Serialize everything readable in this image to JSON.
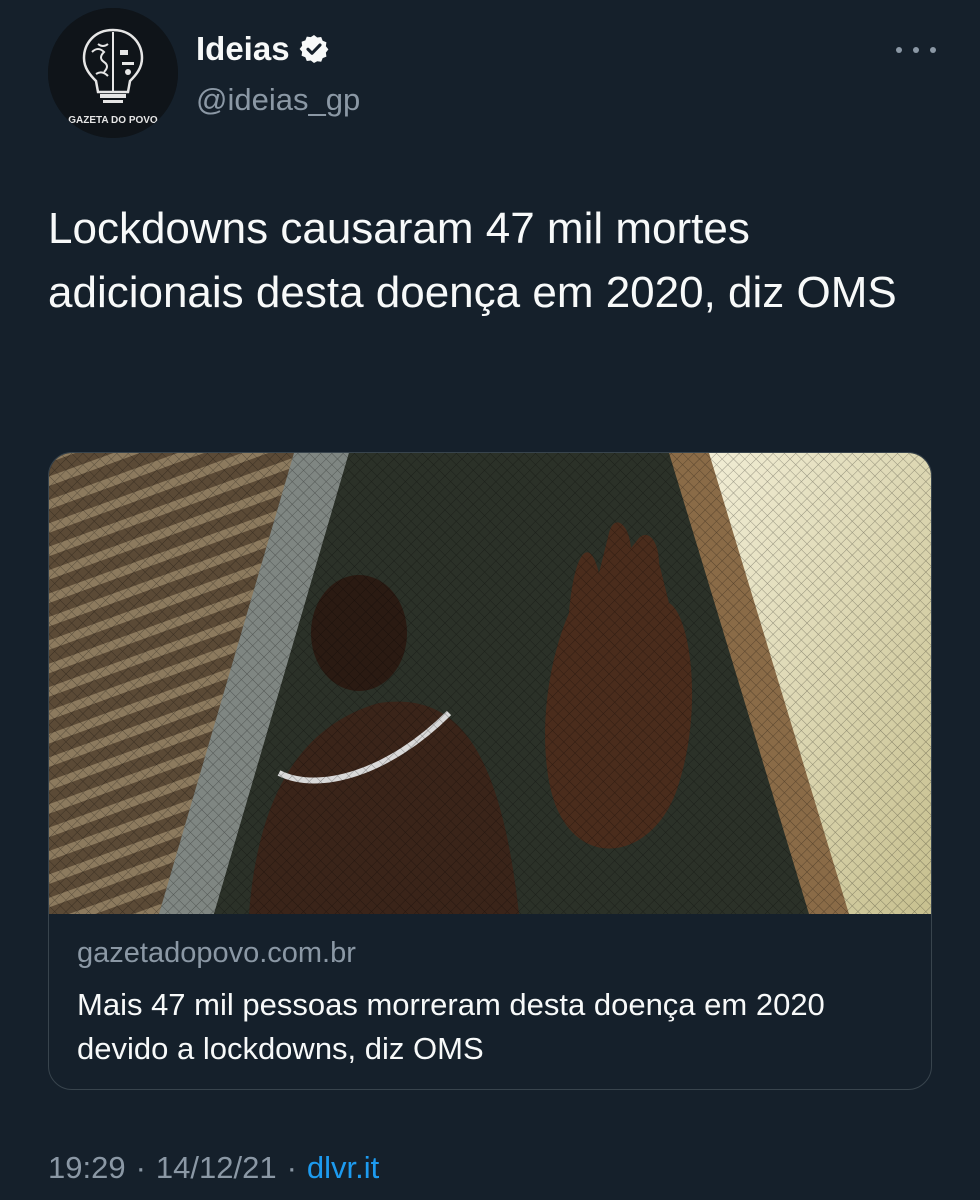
{
  "tweet": {
    "author": {
      "display_name": "Ideias",
      "handle": "@ideias_gp",
      "avatar_label": "GAZETA DO POVO",
      "verified": true
    },
    "text": "Lockdowns causaram 47 mil mortes adicionais desta doença em 2020, diz OMS",
    "card": {
      "domain": "gazetadopovo.com.br",
      "title": "Mais 47 mil pessoas morreram desta doença em 2020 devido a lockdowns, diz OMS"
    },
    "meta": {
      "time": "19:29",
      "separator": "·",
      "date": "14/12/21",
      "source": "dlvr.it"
    }
  },
  "icons": {
    "verified": "verified-badge-icon",
    "more": "more-options-icon"
  },
  "colors": {
    "background": "#15202b",
    "text_primary": "#f7f9f9",
    "text_secondary": "#8b98a5",
    "link": "#1d9bf0",
    "border": "#38444d"
  }
}
